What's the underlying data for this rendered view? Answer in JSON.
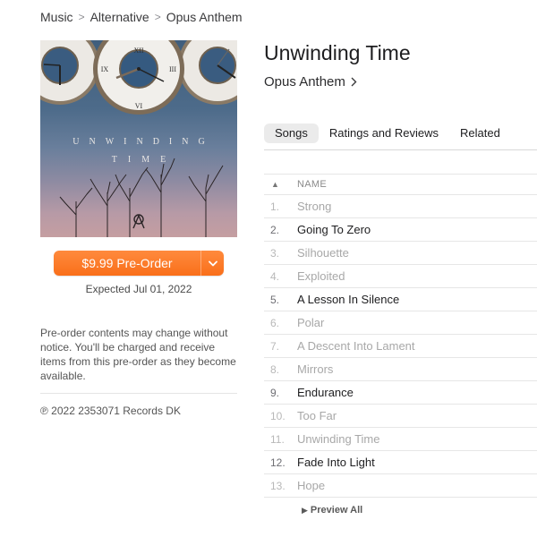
{
  "breadcrumb": [
    {
      "label": "Music"
    },
    {
      "label": "Alternative"
    },
    {
      "label": "Opus Anthem"
    }
  ],
  "breadcrumb_separator": ">",
  "artwork": {
    "line1": "UNWINDING",
    "line2": "TIME",
    "alt": "Unwinding Time album artwork"
  },
  "purchase": {
    "button_label": "$9.99 Pre-Order",
    "expected": "Expected Jul 01, 2022",
    "accent_color": "#f97a26"
  },
  "notice": "Pre-order contents may change without notice. You'll be charged and receive items from this pre-order as they become available.",
  "copyright": "℗ 2022 2353071 Records DK",
  "album": {
    "title": "Unwinding Time",
    "artist": "Opus Anthem"
  },
  "tabs": [
    {
      "label": "Songs",
      "active": true
    },
    {
      "label": "Ratings and Reviews",
      "active": false
    },
    {
      "label": "Related",
      "active": false
    }
  ],
  "tracklist": {
    "sort_indicator": "▲",
    "column_name": "NAME",
    "tracks": [
      {
        "num": "1.",
        "name": "Strong",
        "available": false
      },
      {
        "num": "2.",
        "name": "Going To Zero",
        "available": true
      },
      {
        "num": "3.",
        "name": "Silhouette",
        "available": false
      },
      {
        "num": "4.",
        "name": "Exploited",
        "available": false
      },
      {
        "num": "5.",
        "name": "A Lesson In Silence",
        "available": true
      },
      {
        "num": "6.",
        "name": "Polar",
        "available": false
      },
      {
        "num": "7.",
        "name": "A Descent Into Lament",
        "available": false
      },
      {
        "num": "8.",
        "name": "Mirrors",
        "available": false
      },
      {
        "num": "9.",
        "name": "Endurance",
        "available": true
      },
      {
        "num": "10.",
        "name": "Too Far",
        "available": false
      },
      {
        "num": "11.",
        "name": "Unwinding Time",
        "available": false
      },
      {
        "num": "12.",
        "name": "Fade Into Light",
        "available": true
      },
      {
        "num": "13.",
        "name": "Hope",
        "available": false
      }
    ]
  },
  "preview_all": {
    "icon": "▶",
    "label": "Preview All"
  }
}
